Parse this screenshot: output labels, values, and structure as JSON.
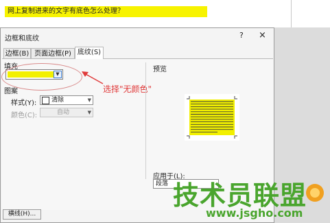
{
  "document": {
    "highlighted_text": "网上复制进来的文字有底色怎么处理？"
  },
  "dialog": {
    "title": "边框和底纹",
    "help": "?",
    "close": "×",
    "tabs": [
      {
        "label": "边框(B)",
        "active": false
      },
      {
        "label": "页面边框(P)",
        "active": false
      },
      {
        "label": "底纹(S)",
        "active": true
      }
    ],
    "fill": {
      "label": "填充",
      "color": "#f2f000"
    },
    "pattern": {
      "label": "图案",
      "style_label": "样式(Y):",
      "style_value": "清除",
      "color_label": "颜色(C):",
      "color_value": "自动"
    },
    "preview": {
      "label": "预览"
    },
    "apply": {
      "label": "应用于(L):",
      "value": "段落"
    },
    "horizontal_line_button": "横线(H)..."
  },
  "annotation": {
    "text": "选择\"无颜色\"",
    "color": "#e03a3a"
  },
  "watermark": {
    "text": "技术员联盟",
    "url": "www.jsgho.com",
    "color": "#4aa52e"
  },
  "icons": [
    "help-icon",
    "close-icon",
    "chevron-down-icon",
    "red-arrow-icon"
  ]
}
